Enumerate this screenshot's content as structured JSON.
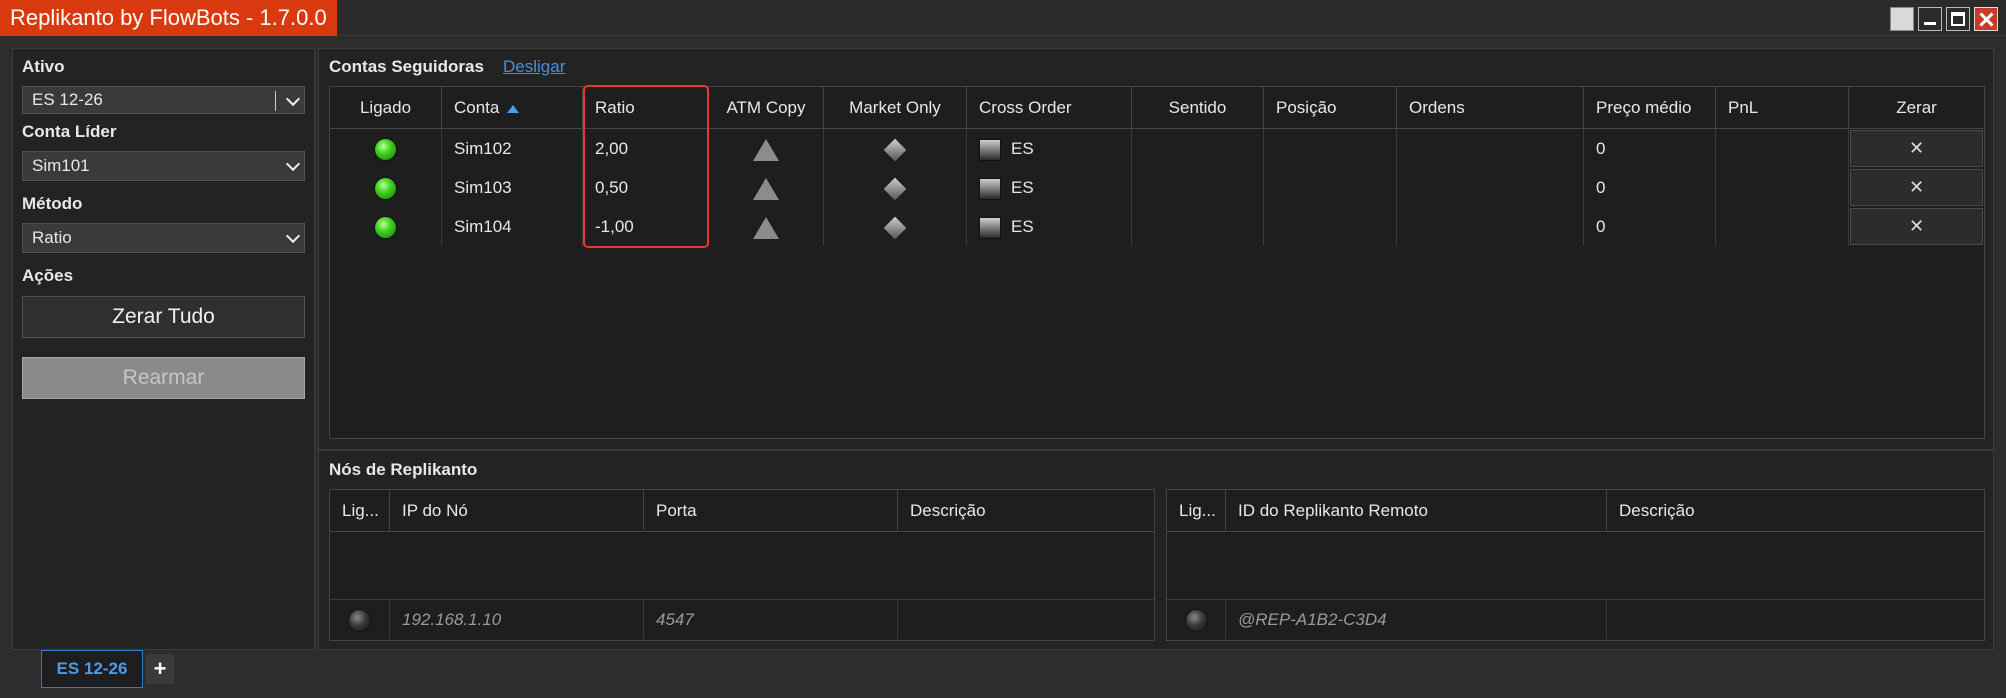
{
  "window": {
    "title": "Replikanto by FlowBots - 1.7.0.0"
  },
  "left": {
    "ativo_label": "Ativo",
    "ativo_value": "ES 12-26",
    "conta_lider_label": "Conta Líder",
    "conta_lider_value": "Sim101",
    "metodo_label": "Método",
    "metodo_value": "Ratio",
    "acoes_label": "Ações",
    "zerar_tudo": "Zerar Tudo",
    "rearmar": "Rearmar"
  },
  "seguidoras": {
    "title": "Contas Seguidoras",
    "desligar": "Desligar",
    "columns": {
      "ligado": "Ligado",
      "conta": "Conta",
      "ratio": "Ratio",
      "atm": "ATM Copy",
      "market": "Market Only",
      "cross": "Cross Order",
      "sentido": "Sentido",
      "posicao": "Posição",
      "ordens": "Ordens",
      "preco": "Preço médio",
      "pnl": "PnL",
      "zerar": "Zerar"
    },
    "rows": [
      {
        "conta": "Sim102",
        "ratio": "2,00",
        "cross": "ES",
        "preco": "0",
        "zerar": "✕",
        "ligado": true
      },
      {
        "conta": "Sim103",
        "ratio": "0,50",
        "cross": "ES",
        "preco": "0",
        "zerar": "✕",
        "ligado": true
      },
      {
        "conta": "Sim104",
        "ratio": "-1,00",
        "cross": "ES",
        "preco": "0",
        "zerar": "✕",
        "ligado": true
      }
    ]
  },
  "nos": {
    "title": "Nós de Replikanto",
    "left_columns": {
      "lig": "Lig...",
      "ip": "IP do Nó",
      "porta": "Porta",
      "descricao": "Descrição"
    },
    "left_new": {
      "ip": "192.168.1.10",
      "porta": "4547"
    },
    "right_columns": {
      "lig": "Lig...",
      "id": "ID do Replikanto Remoto",
      "descricao": "Descrição"
    },
    "right_new": {
      "id": "@REP-A1B2-C3D4"
    }
  },
  "tabs": {
    "active": "ES 12-26",
    "add": "+"
  },
  "colors": {
    "title_bg": "#d9390f",
    "link": "#4a8fd9",
    "highlight": "#e53935",
    "led_on": "#3ed11e"
  }
}
